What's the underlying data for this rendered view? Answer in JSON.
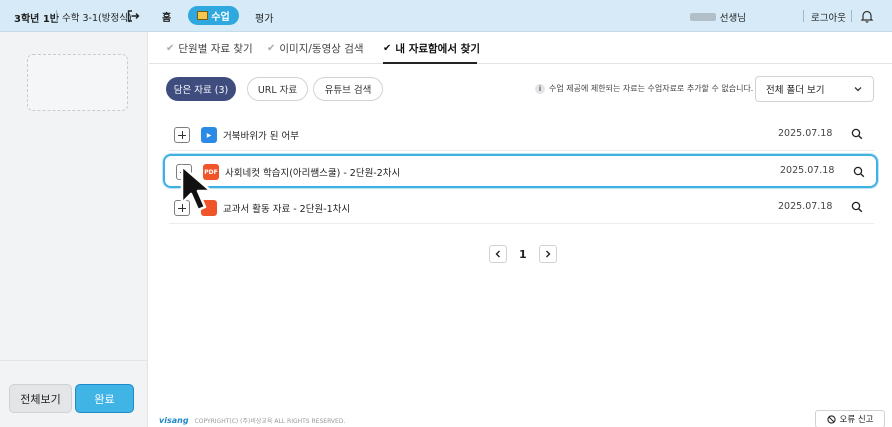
{
  "topbar": {
    "class_label": "3학년 1반",
    "course_label": "수학 3-1(방정식)",
    "nav_home": "홈",
    "nav_class": "수업",
    "nav_eval": "평가",
    "teacher_suffix": "선생님",
    "logout": "로그아웃"
  },
  "left": {
    "btn_all": "전체보기",
    "btn_done": "완료"
  },
  "tabs": [
    {
      "label": "단원별 자료 찾기",
      "active": false
    },
    {
      "label": "이미지/동영상 검색",
      "active": false
    },
    {
      "label": "내 자료함에서 찾기",
      "active": true
    }
  ],
  "filters": {
    "saved": "담은 자료 (3)",
    "url": "URL 자료",
    "youtube": "유튜브 검색",
    "notice": "수업 제공에 제한되는 자료는 수업자료로 추가할 수 없습니다.",
    "folder_select": "전체 폴더 보기"
  },
  "items": [
    {
      "type": "video",
      "badge": "▶",
      "title": "거북바위가 된 어부",
      "date": "2025.07.18"
    },
    {
      "type": "pdf",
      "badge": "PDF",
      "title": "사회네컷 학습지(아리쌤스쿨) - 2단원-2차시",
      "date": "2025.07.18"
    },
    {
      "type": "pdf",
      "badge": "",
      "title": "교과서 활동 자료 - 2단원-1차시",
      "date": "2025.07.18"
    }
  ],
  "pager": {
    "current": "1"
  },
  "footer": {
    "brand": "visang",
    "copyright": "COPYRIGHT(C) (주)비상교육 ALL RIGHTS RESERVED.",
    "report": "오류 신고"
  },
  "colors": {
    "accent": "#41b4e6",
    "topbar_bg": "#d6ebf7",
    "pill_active": "#3e4d7e",
    "pdf_badge": "#f0552a",
    "video_badge": "#2a8ae6"
  }
}
